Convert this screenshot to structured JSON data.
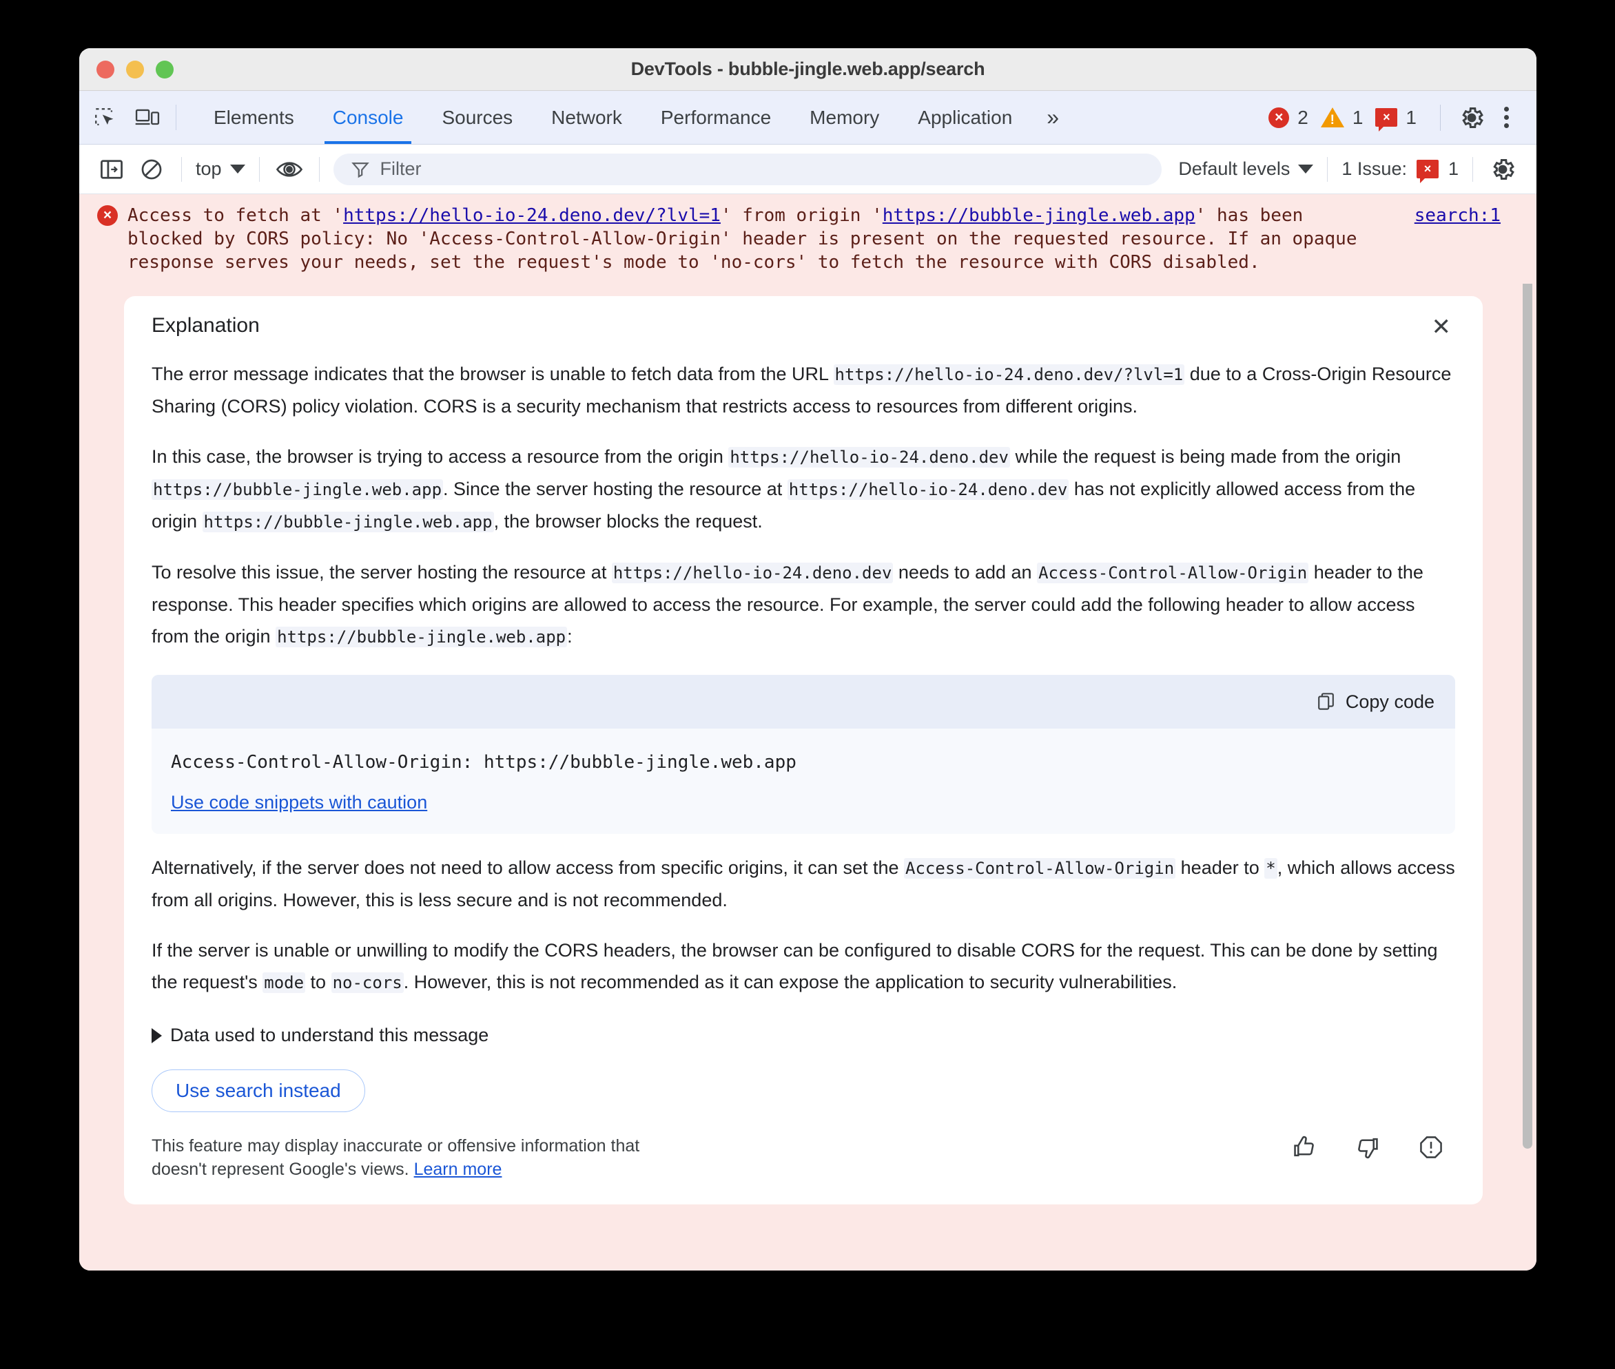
{
  "window": {
    "title": "DevTools - bubble-jingle.web.app/search",
    "traffic_lights": [
      "close",
      "minimize",
      "maximize"
    ]
  },
  "tabbar": {
    "left_icons": [
      "inspect-element-icon",
      "device-toolbar-icon"
    ],
    "tabs": [
      {
        "label": "Elements",
        "active": false
      },
      {
        "label": "Console",
        "active": true
      },
      {
        "label": "Sources",
        "active": false
      },
      {
        "label": "Network",
        "active": false
      },
      {
        "label": "Performance",
        "active": false
      },
      {
        "label": "Memory",
        "active": false
      },
      {
        "label": "Application",
        "active": false
      }
    ],
    "more_tabs_label": "»",
    "error_count": "2",
    "warning_count": "1",
    "issue_count": "1",
    "error_glyph": "×",
    "warning_glyph": "!",
    "issue_glyph": "×",
    "settings_icon": "gear-icon",
    "menu_icon": "kebab-menu-icon"
  },
  "console_toolbar": {
    "sidebar_icon": "console-sidebar-icon",
    "clear_icon": "clear-console-icon",
    "context_value": "top",
    "eye_icon": "live-expression-icon",
    "filter": {
      "icon": "filter-icon",
      "placeholder": "Filter",
      "value": ""
    },
    "levels_value": "Default levels",
    "issues_label": "1 Issue:",
    "issues_count": "1",
    "issues_glyph": "×",
    "settings_icon": "console-settings-icon"
  },
  "console_error": {
    "icon_glyph": "×",
    "prefix": "Access to fetch at '",
    "url1": "https://hello-io-24.deno.dev/?lvl=1",
    "mid": "' from origin '",
    "url2": "https://bubble-jingle.web.app",
    "suffix": "' has been blocked by CORS policy: No 'Access-Control-Allow-Origin' header is present on the requested resource. If an opaque response serves your needs, set the request's mode to 'no-cors' to fetch the resource with CORS disabled.",
    "source_link": "search:1"
  },
  "explanation": {
    "title": "Explanation",
    "close_glyph": "✕",
    "paragraph1": {
      "a": "The error message indicates that the browser is unable to fetch data from the URL ",
      "code1": "https://hello-io-24.deno.dev/?lvl=1",
      "b": " due to a Cross-Origin Resource Sharing (CORS) policy violation. CORS is a security mechanism that restricts access to resources from different origins."
    },
    "paragraph2": {
      "a": "In this case, the browser is trying to access a resource from the origin ",
      "code1": "https://hello-io-24.deno.dev",
      "b": " while the request is being made from the origin ",
      "code2": "https://bubble-jingle.web.app",
      "c": ". Since the server hosting the resource at ",
      "code3": "https://hello-io-24.deno.dev",
      "d": " has not explicitly allowed access from the origin ",
      "code4": "https://bubble-jingle.web.app",
      "e": ", the browser blocks the request."
    },
    "paragraph3": {
      "a": "To resolve this issue, the server hosting the resource at ",
      "code1": "https://hello-io-24.deno.dev",
      "b": " needs to add an ",
      "code2": "Access-Control-Allow-Origin",
      "c": " header to the response. This header specifies which origins are allowed to access the resource. For example, the server could add the following header to allow access from the origin ",
      "code3": "https://bubble-jingle.web.app",
      "d": ":"
    },
    "code_block": {
      "copy_label": "Copy code",
      "copy_icon": "copy-icon",
      "code": "Access-Control-Allow-Origin: https://bubble-jingle.web.app",
      "caution_link": "Use code snippets with caution"
    },
    "paragraph4": {
      "a": "Alternatively, if the server does not need to allow access from specific origins, it can set the ",
      "code1": "Access-Control-Allow-Origin",
      "b": " header to ",
      "code2": "*",
      "c": ", which allows access from all origins. However, this is less secure and is not recommended."
    },
    "paragraph5": {
      "a": "If the server is unable or unwilling to modify the CORS headers, the browser can be configured to disable CORS for the request. This can be done by setting the request's ",
      "code1": "mode",
      "b": " to ",
      "code2": "no-cors",
      "c": ". However, this is not recommended as it can expose the application to security vulnerabilities."
    },
    "disclosure_label": "Data used to understand this message",
    "use_search_button": "Use search instead",
    "disclaimer_line1": "This feature may display inaccurate or offensive information that",
    "disclaimer_line2": "doesn't represent Google's views. ",
    "disclaimer_link": "Learn more",
    "feedback_icons": [
      "thumb-up-icon",
      "thumb-down-icon",
      "report-icon"
    ]
  },
  "colors": {
    "accent_blue": "#1a73e8",
    "error_red": "#d93025",
    "warning_orange": "#f29900",
    "error_bg": "#fce8e6",
    "tabbar_bg": "#ebeffb",
    "link_blue": "#1a0dab"
  }
}
